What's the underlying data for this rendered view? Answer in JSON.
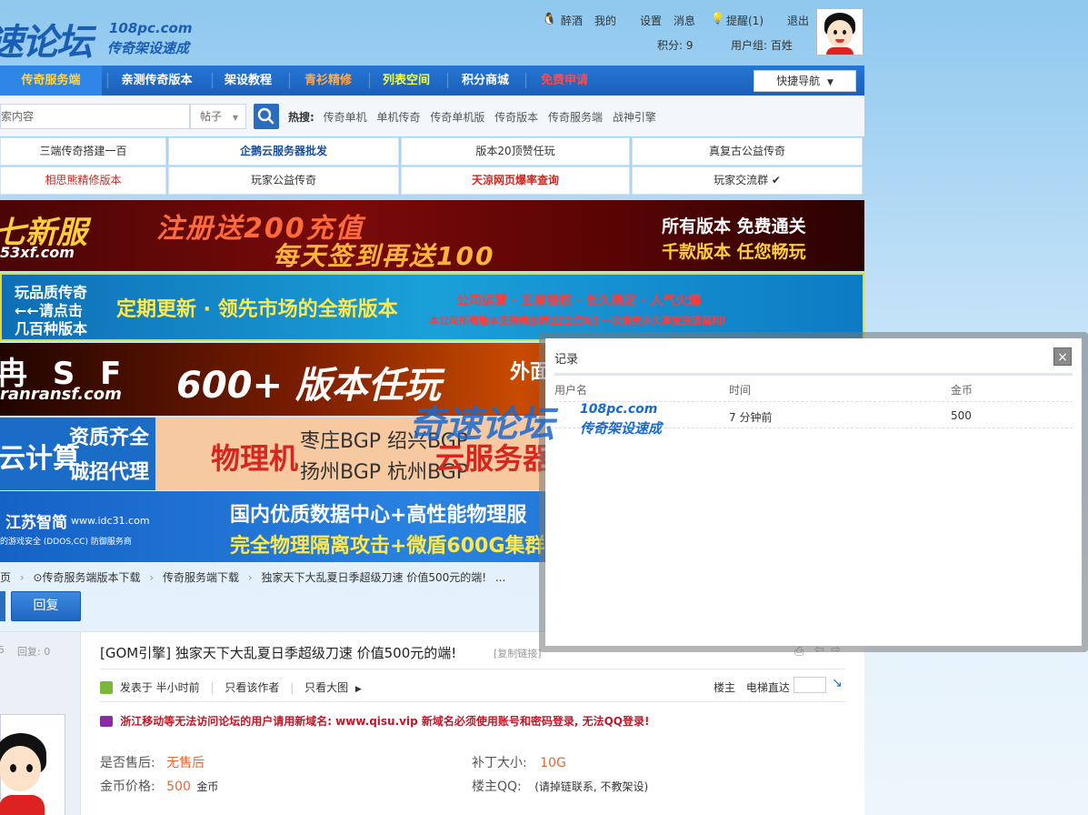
{
  "header": {
    "logo_text": "速论坛",
    "logo_domain": "108pc.com",
    "logo_tagline": "传奇架设速成",
    "user": {
      "name": "醉酒",
      "my": "我的",
      "settings": "设置",
      "messages": "消息",
      "reminder": "提醒(1)",
      "logout": "退出",
      "points": "积分: 9",
      "group": "用户组: 百姓"
    }
  },
  "nav": {
    "items": [
      "传奇服务端",
      "亲测传奇版本",
      "架设教程",
      "青衫精修",
      "列表空间",
      "积分商城",
      "免费申请"
    ],
    "quick_nav": "快捷导航"
  },
  "search": {
    "placeholder": "索内容",
    "type": "帖子",
    "hot_label": "热搜:",
    "hot_items": [
      "传奇单机",
      "单机传奇",
      "传奇单机版",
      "传奇版本",
      "传奇服务端",
      "战神引擎"
    ]
  },
  "links": {
    "row1": [
      "三端传奇搭建一百",
      "企鹅云服务器批发",
      "版本20顶赞任玩",
      "真复古公益传奇"
    ],
    "row2": [
      "相思熊精修版本",
      "玩家公益传奇",
      "天涼网页爆率查询",
      "玩家交流群 ✔"
    ]
  },
  "banners": {
    "b1": [
      "七新服",
      "注册送200充值",
      "每天签到再送100",
      "所有版本 免费通关",
      "千款版本 任您畅玩",
      "53xf.com"
    ],
    "b2": [
      "玩品质传奇",
      "←←请点击",
      "几百种版本",
      "定期更新 · 领先市场的全新版本",
      "公司运营 · 五星授权 · 长久稳定 · 人气火爆",
      "本公司所有版本支持跨服转区[全自动] 一次消费永久享受充值福利!"
    ],
    "b3": [
      "冉 S F",
      "600+ 版本任玩",
      "外面几",
      "ranransf.com"
    ],
    "b4": [
      "云计算",
      "资质齐全",
      "诚招代理",
      "物理机",
      "枣庄BGP 绍兴BGP",
      "扬州BGP 杭州BGP",
      "云服务器"
    ],
    "b5": [
      "江苏智简",
      "www.idc31.com",
      "国内优质数据中心+高性能物理服",
      "完全物理隔离攻击+微盾600G集群",
      "的游戏安全 (DDOS,CC) 防御服务商"
    ]
  },
  "breadcrumb": [
    "页",
    "⊙传奇服务端版本下载",
    "传奇服务端下载",
    "独家天下大乱夏日季超级刀速 价值500元的端!",
    "..."
  ],
  "reply_label": "回复",
  "post": {
    "side_views": "5",
    "side_replies": "回复: 0",
    "title": "[GOM引擎] 独家天下大乱夏日季超级刀速 价值500元的端!",
    "copy_link": "[复制链接]",
    "posted": "发表于 半小时前",
    "only_author": "只看该作者",
    "only_big": "只看大图",
    "floor_owner": "楼主",
    "elevator": "电梯直达",
    "notice": "浙江移动等无法访问论坛的用户请用新域名: www.qisu.vip  新域名必须使用账号和密码登录, 无法QQ登录!",
    "after_sale_label": "是否售后:",
    "after_sale_value": "无售后",
    "price_label": "金币价格:",
    "price_value": "500",
    "price_unit": "金币",
    "patch_label": "补丁大小:",
    "patch_value": "10G",
    "qq_label": "楼主QQ:",
    "qq_value": "(请掉链联系, 不教架设)"
  },
  "dialog": {
    "title": "记录",
    "close": "×",
    "columns": [
      "用户名",
      "时间",
      "金币"
    ],
    "rows": [
      {
        "user": "",
        "time": "7 分钟前",
        "coins": "500"
      }
    ]
  },
  "watermark": {
    "main": "奇速论坛",
    "domain": "108pc.com",
    "tagline": "传奇架设速成"
  }
}
